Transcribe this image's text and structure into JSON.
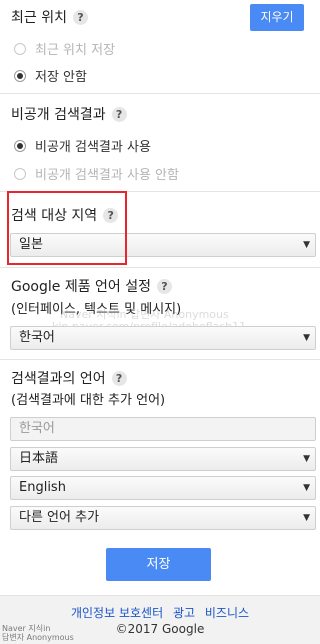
{
  "recent_location": {
    "title": "최근 위치",
    "help": "?",
    "clear_button": "지우기",
    "options": [
      {
        "label": "최근 위치 저장",
        "selected": false,
        "disabled": true
      },
      {
        "label": "저장 안함",
        "selected": true,
        "disabled": false
      }
    ]
  },
  "private_results": {
    "title": "비공개 검색결과",
    "help": "?",
    "options": [
      {
        "label": "비공개 검색결과 사용",
        "selected": true,
        "disabled": false
      },
      {
        "label": "비공개 검색결과 사용 안함",
        "selected": false,
        "disabled": true
      }
    ]
  },
  "search_region": {
    "title": "검색 대상 지역",
    "help": "?",
    "selected": "일본"
  },
  "product_language": {
    "title": "Google 제품 언어 설정",
    "help": "?",
    "subtitle": "(인터페이스, 텍스트 및 메시지)",
    "selected": "한국어"
  },
  "result_language": {
    "title": "검색결과의 언어",
    "help": "?",
    "subtitle": "(검색결과에 대한 추가 언어)",
    "rows": [
      "한국어",
      "日本語",
      "English",
      "다른 언어 추가"
    ]
  },
  "save_button": "저장",
  "footer": {
    "links": [
      "개인정보 보호센터",
      "광고",
      "비즈니스"
    ],
    "copyright": "©2017 Google"
  },
  "watermark": {
    "line1": "Naver 지식in 답변자 Anonymous",
    "line2": "kin.naver.com/profile/adobeflash11"
  },
  "corner_watermark": {
    "line1": "Naver 지식in",
    "line2": "답변자 Anonymous"
  },
  "colors": {
    "accent": "#4a8af4",
    "highlight": "#e8262c",
    "link": "#1a55c9"
  }
}
